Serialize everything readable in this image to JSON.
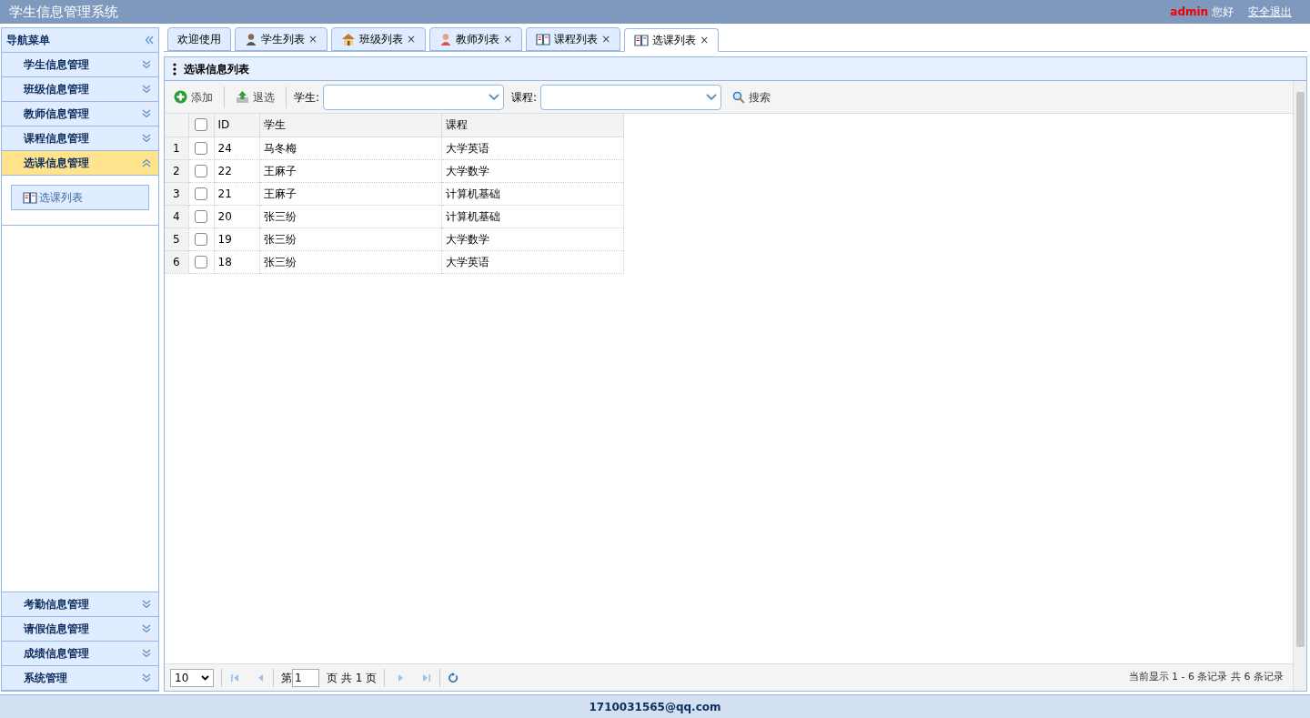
{
  "header": {
    "title": "学生信息管理系统",
    "user": "admin",
    "greeting": "您好",
    "logout": "安全退出"
  },
  "sidebar": {
    "title": "导航菜单",
    "sections_top": [
      {
        "label": "学生信息管理",
        "expanded": false
      },
      {
        "label": "班级信息管理",
        "expanded": false
      },
      {
        "label": "教师信息管理",
        "expanded": false
      },
      {
        "label": "课程信息管理",
        "expanded": false
      },
      {
        "label": "选课信息管理",
        "expanded": true,
        "items": [
          {
            "label": "选课列表"
          }
        ]
      }
    ],
    "sections_bottom": [
      {
        "label": "考勤信息管理",
        "expanded": false
      },
      {
        "label": "请假信息管理",
        "expanded": false
      },
      {
        "label": "成绩信息管理",
        "expanded": false
      },
      {
        "label": "系统管理",
        "expanded": false
      }
    ]
  },
  "tabs": [
    {
      "label": "欢迎使用",
      "kind": "plain",
      "selected": false
    },
    {
      "label": "学生列表",
      "kind": "person",
      "selected": false
    },
    {
      "label": "班级列表",
      "kind": "house",
      "selected": false
    },
    {
      "label": "教师列表",
      "kind": "teacher",
      "selected": false
    },
    {
      "label": "课程列表",
      "kind": "book",
      "selected": false
    },
    {
      "label": "选课列表",
      "kind": "book",
      "selected": true
    }
  ],
  "close_mark": "×",
  "panel": {
    "title": "选课信息列表"
  },
  "toolbar": {
    "add": "添加",
    "remove": "退选",
    "student_label": "学生:",
    "course_label": "课程:",
    "search": "搜索"
  },
  "table": {
    "select_all_checked": false,
    "columns": [
      "ID",
      "学生",
      "课程"
    ],
    "rows": [
      {
        "index": "1",
        "checked": false,
        "cells": [
          "24",
          "马冬梅",
          "大学英语"
        ]
      },
      {
        "index": "2",
        "checked": false,
        "cells": [
          "22",
          "王麻子",
          "大学数学"
        ]
      },
      {
        "index": "3",
        "checked": false,
        "cells": [
          "21",
          "王麻子",
          "计算机基础"
        ]
      },
      {
        "index": "4",
        "checked": false,
        "cells": [
          "20",
          "张三纷",
          "计算机基础"
        ]
      },
      {
        "index": "5",
        "checked": false,
        "cells": [
          "19",
          "张三纷",
          "大学数学"
        ]
      },
      {
        "index": "6",
        "checked": false,
        "cells": [
          "18",
          "张三纷",
          "大学英语"
        ]
      }
    ]
  },
  "pager": {
    "page_size": "10",
    "page_prefix": "第",
    "page": "1",
    "page_suffix": "页 共 1 页",
    "info": "当前显示 1 - 6 条记录 共 6 条记录"
  },
  "footer": {
    "email": "1710031565@qq.com"
  }
}
